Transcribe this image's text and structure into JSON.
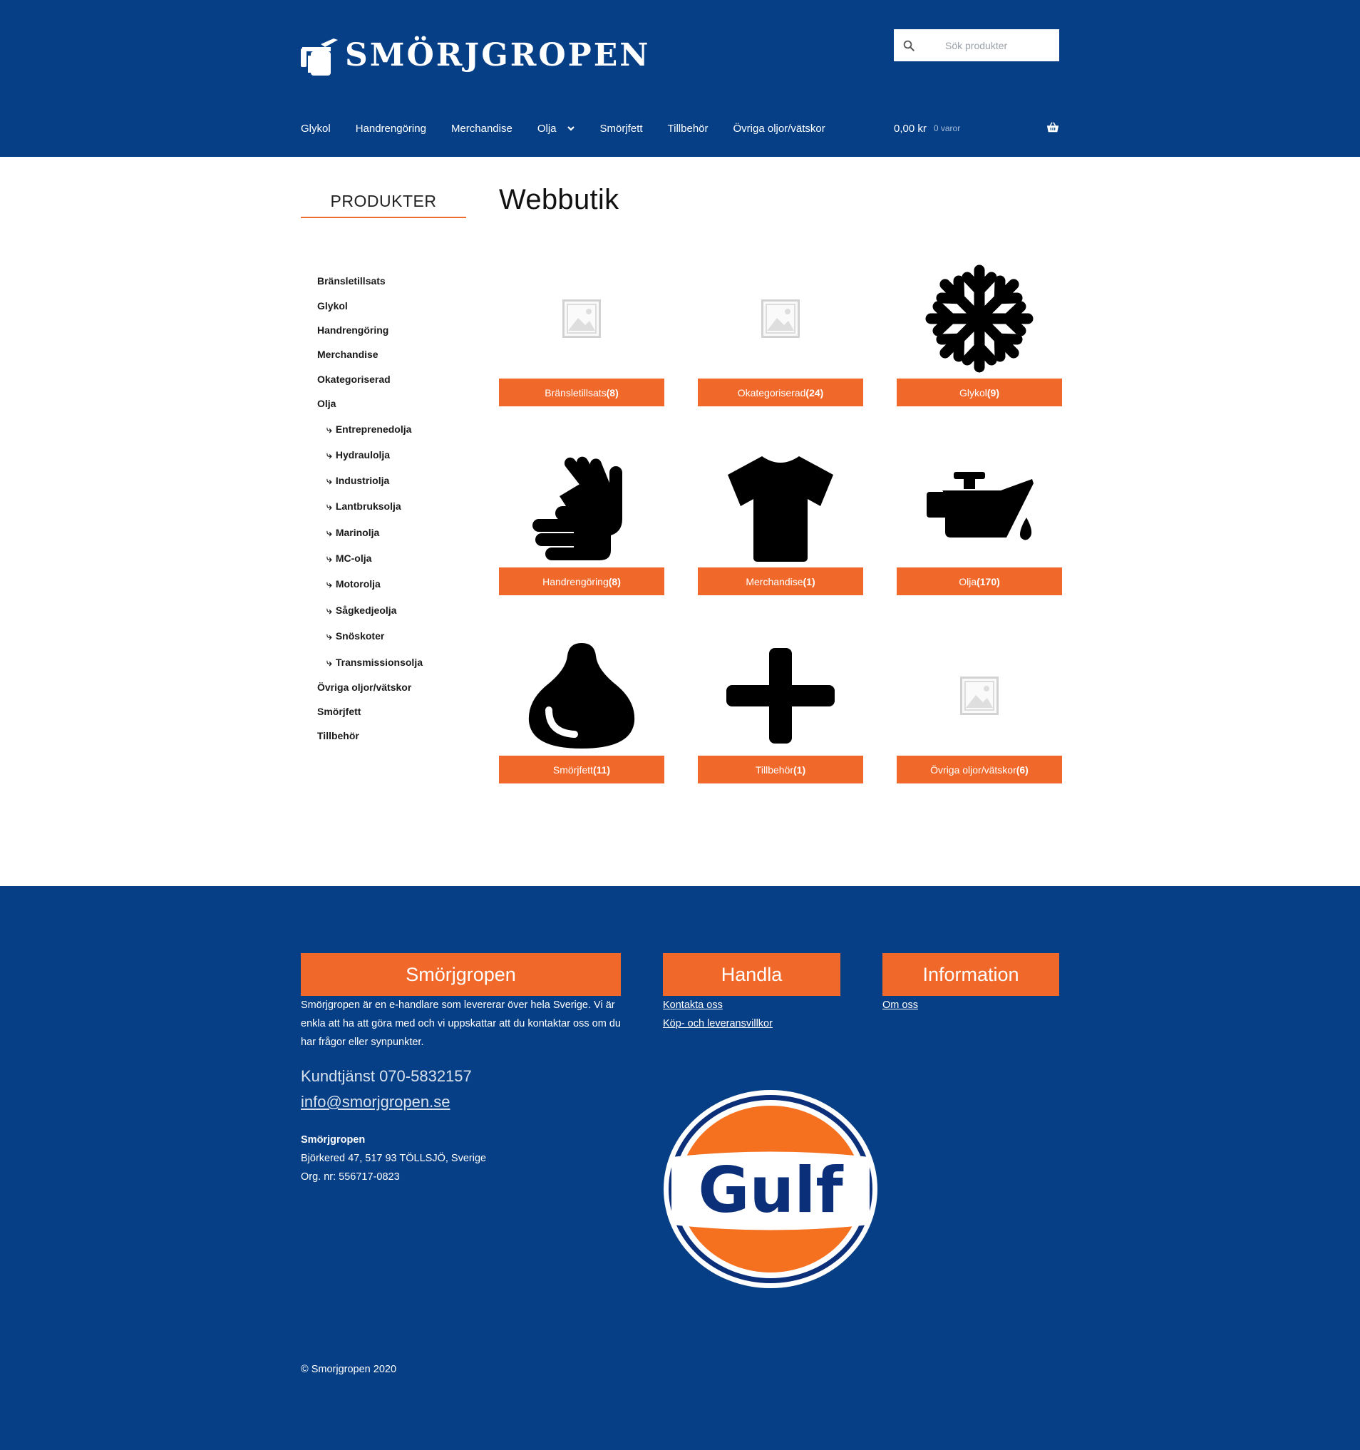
{
  "header": {
    "logo_text": "Smörjgropen",
    "search_placeholder": "Sök produkter",
    "nav": [
      "Glykol",
      "Handrengöring",
      "Merchandise",
      "Olja",
      "Smörjfett",
      "Tillbehör",
      "Övriga oljor/vätskor"
    ],
    "cart_total": "0,00 kr",
    "cart_count": "0 varor"
  },
  "sidebar": {
    "title": "PRODUKTER",
    "categories": [
      "Bränsletillsats",
      "Glykol",
      "Handrengöring",
      "Merchandise",
      "Okategoriserad",
      "Olja"
    ],
    "subcategories": [
      "Entreprenedolja",
      "Hydraulolja",
      "Industriolja",
      "Lantbruksolja",
      "Marinolja",
      "MC-olja",
      "Motorolja",
      "Sågkedjeolja",
      "Snöskoter",
      "Transmissionsolja"
    ],
    "categories_after": [
      "Övriga oljor/vätskor",
      "Smörjfett",
      "Tillbehör"
    ],
    "sub_arrow": "⤷"
  },
  "main": {
    "title": "Webbutik",
    "products": [
      {
        "name": "Bränsletillsats",
        "count": "(8)",
        "icon": "placeholder-icon"
      },
      {
        "name": "Okategoriserad",
        "count": "(24)",
        "icon": "placeholder-icon"
      },
      {
        "name": "Glykol",
        "count": "(9)",
        "icon": "snowflake-icon"
      },
      {
        "name": "Handrengöring",
        "count": "(8)",
        "icon": "hands-icon"
      },
      {
        "name": "Merchandise",
        "count": "(1)",
        "icon": "tshirt-icon"
      },
      {
        "name": "Olja",
        "count": "(170)",
        "icon": "oil-can-icon"
      },
      {
        "name": "Smörjfett",
        "count": "(11)",
        "icon": "drop-icon"
      },
      {
        "name": "Tillbehör",
        "count": "(1)",
        "icon": "plus-icon"
      },
      {
        "name": "Övriga oljor/vätskor",
        "count": "(6)",
        "icon": "placeholder-icon"
      }
    ]
  },
  "footer": {
    "col1_title": "Smörjgropen",
    "col1_text": "Smörjgropen är en e-handlare som levererar över hela Sverige. Vi är enkla att ha att göra med och vi uppskattar att du kontaktar oss om du har frågor eller synpunkter.",
    "phone": "Kundtjänst 070-5832157",
    "email": "info@smorjgropen.se",
    "company": "Smörjgropen",
    "address": "Björkered 47, 517 93 TÖLLSJÖ, Sverige",
    "org": "Org. nr: 556717-0823",
    "col2_title": "Handla",
    "col2_links": [
      "Kontakta oss",
      "Köp- och leveransvillkor"
    ],
    "col3_title": "Information",
    "col3_links": [
      "Om oss"
    ],
    "gulf_text": "Gulf",
    "copyright": "© Smorjgropen 2020"
  },
  "colors": {
    "primary": "#063f85",
    "accent": "#f0692b"
  }
}
